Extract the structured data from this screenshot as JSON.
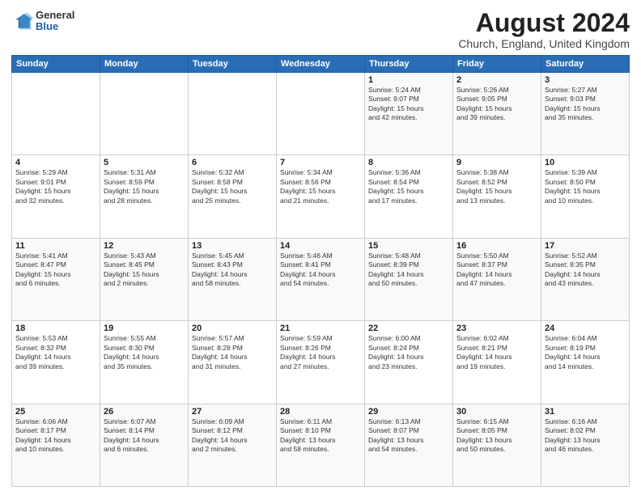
{
  "header": {
    "logo": {
      "general": "General",
      "blue": "Blue"
    },
    "month_year": "August 2024",
    "location": "Church, England, United Kingdom"
  },
  "weekdays": [
    "Sunday",
    "Monday",
    "Tuesday",
    "Wednesday",
    "Thursday",
    "Friday",
    "Saturday"
  ],
  "rows": [
    [
      {
        "day": "",
        "info": ""
      },
      {
        "day": "",
        "info": ""
      },
      {
        "day": "",
        "info": ""
      },
      {
        "day": "",
        "info": ""
      },
      {
        "day": "1",
        "info": "Sunrise: 5:24 AM\nSunset: 9:07 PM\nDaylight: 15 hours\nand 42 minutes."
      },
      {
        "day": "2",
        "info": "Sunrise: 5:26 AM\nSunset: 9:05 PM\nDaylight: 15 hours\nand 39 minutes."
      },
      {
        "day": "3",
        "info": "Sunrise: 5:27 AM\nSunset: 9:03 PM\nDaylight: 15 hours\nand 35 minutes."
      }
    ],
    [
      {
        "day": "4",
        "info": "Sunrise: 5:29 AM\nSunset: 9:01 PM\nDaylight: 15 hours\nand 32 minutes."
      },
      {
        "day": "5",
        "info": "Sunrise: 5:31 AM\nSunset: 8:59 PM\nDaylight: 15 hours\nand 28 minutes."
      },
      {
        "day": "6",
        "info": "Sunrise: 5:32 AM\nSunset: 8:58 PM\nDaylight: 15 hours\nand 25 minutes."
      },
      {
        "day": "7",
        "info": "Sunrise: 5:34 AM\nSunset: 8:56 PM\nDaylight: 15 hours\nand 21 minutes."
      },
      {
        "day": "8",
        "info": "Sunrise: 5:36 AM\nSunset: 8:54 PM\nDaylight: 15 hours\nand 17 minutes."
      },
      {
        "day": "9",
        "info": "Sunrise: 5:38 AM\nSunset: 8:52 PM\nDaylight: 15 hours\nand 13 minutes."
      },
      {
        "day": "10",
        "info": "Sunrise: 5:39 AM\nSunset: 8:50 PM\nDaylight: 15 hours\nand 10 minutes."
      }
    ],
    [
      {
        "day": "11",
        "info": "Sunrise: 5:41 AM\nSunset: 8:47 PM\nDaylight: 15 hours\nand 6 minutes."
      },
      {
        "day": "12",
        "info": "Sunrise: 5:43 AM\nSunset: 8:45 PM\nDaylight: 15 hours\nand 2 minutes."
      },
      {
        "day": "13",
        "info": "Sunrise: 5:45 AM\nSunset: 8:43 PM\nDaylight: 14 hours\nand 58 minutes."
      },
      {
        "day": "14",
        "info": "Sunrise: 5:46 AM\nSunset: 8:41 PM\nDaylight: 14 hours\nand 54 minutes."
      },
      {
        "day": "15",
        "info": "Sunrise: 5:48 AM\nSunset: 8:39 PM\nDaylight: 14 hours\nand 50 minutes."
      },
      {
        "day": "16",
        "info": "Sunrise: 5:50 AM\nSunset: 8:37 PM\nDaylight: 14 hours\nand 47 minutes."
      },
      {
        "day": "17",
        "info": "Sunrise: 5:52 AM\nSunset: 8:35 PM\nDaylight: 14 hours\nand 43 minutes."
      }
    ],
    [
      {
        "day": "18",
        "info": "Sunrise: 5:53 AM\nSunset: 8:32 PM\nDaylight: 14 hours\nand 39 minutes."
      },
      {
        "day": "19",
        "info": "Sunrise: 5:55 AM\nSunset: 8:30 PM\nDaylight: 14 hours\nand 35 minutes."
      },
      {
        "day": "20",
        "info": "Sunrise: 5:57 AM\nSunset: 8:28 PM\nDaylight: 14 hours\nand 31 minutes."
      },
      {
        "day": "21",
        "info": "Sunrise: 5:59 AM\nSunset: 8:26 PM\nDaylight: 14 hours\nand 27 minutes."
      },
      {
        "day": "22",
        "info": "Sunrise: 6:00 AM\nSunset: 8:24 PM\nDaylight: 14 hours\nand 23 minutes."
      },
      {
        "day": "23",
        "info": "Sunrise: 6:02 AM\nSunset: 8:21 PM\nDaylight: 14 hours\nand 19 minutes."
      },
      {
        "day": "24",
        "info": "Sunrise: 6:04 AM\nSunset: 8:19 PM\nDaylight: 14 hours\nand 14 minutes."
      }
    ],
    [
      {
        "day": "25",
        "info": "Sunrise: 6:06 AM\nSunset: 8:17 PM\nDaylight: 14 hours\nand 10 minutes."
      },
      {
        "day": "26",
        "info": "Sunrise: 6:07 AM\nSunset: 8:14 PM\nDaylight: 14 hours\nand 6 minutes."
      },
      {
        "day": "27",
        "info": "Sunrise: 6:09 AM\nSunset: 8:12 PM\nDaylight: 14 hours\nand 2 minutes."
      },
      {
        "day": "28",
        "info": "Sunrise: 6:11 AM\nSunset: 8:10 PM\nDaylight: 13 hours\nand 58 minutes."
      },
      {
        "day": "29",
        "info": "Sunrise: 6:13 AM\nSunset: 8:07 PM\nDaylight: 13 hours\nand 54 minutes."
      },
      {
        "day": "30",
        "info": "Sunrise: 6:15 AM\nSunset: 8:05 PM\nDaylight: 13 hours\nand 50 minutes."
      },
      {
        "day": "31",
        "info": "Sunrise: 6:16 AM\nSunset: 8:02 PM\nDaylight: 13 hours\nand 46 minutes."
      }
    ]
  ]
}
